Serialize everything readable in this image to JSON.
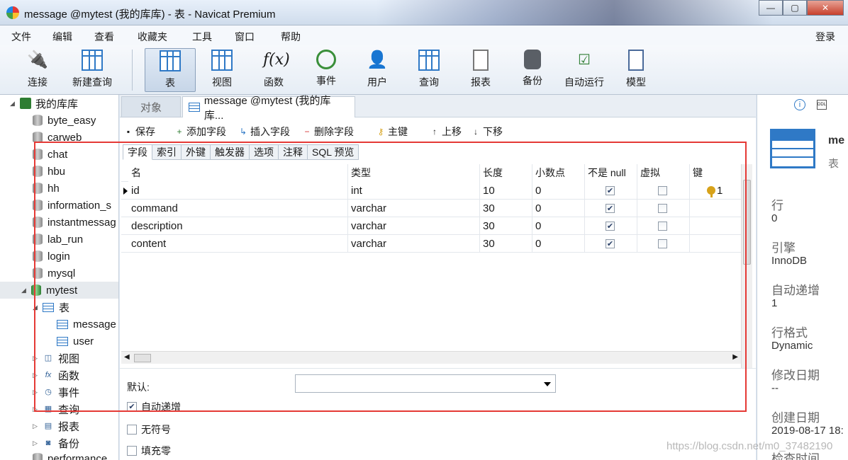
{
  "window": {
    "title": "message @mytest (我的库库) - 表 - Navicat Premium",
    "controls": [
      "—",
      "▢",
      "✕"
    ]
  },
  "menu": {
    "items": [
      "文件",
      "编辑",
      "查看",
      "收藏夹",
      "工具",
      "窗口",
      "帮助"
    ],
    "login": "登录"
  },
  "toolbar": {
    "buttons": [
      {
        "label": "连接",
        "icon": "plug-icon"
      },
      {
        "label": "新建查询",
        "icon": "new-query-icon"
      },
      {
        "label": "表",
        "icon": "table-icon"
      },
      {
        "label": "视图",
        "icon": "view-icon"
      },
      {
        "label": "函数",
        "icon": "function-icon"
      },
      {
        "label": "事件",
        "icon": "clock-icon"
      },
      {
        "label": "用户",
        "icon": "user-icon"
      },
      {
        "label": "查询",
        "icon": "query-icon"
      },
      {
        "label": "报表",
        "icon": "report-icon"
      },
      {
        "label": "备份",
        "icon": "backup-icon"
      },
      {
        "label": "自动运行",
        "icon": "checklist-icon"
      },
      {
        "label": "模型",
        "icon": "model-icon"
      }
    ],
    "active": "表"
  },
  "tree": {
    "connection": "我的库库",
    "databases": [
      "byte_easy",
      "carweb",
      "chat",
      "hbu",
      "hh",
      "information_s",
      "instantmessag",
      "lab_run",
      "login",
      "mysql",
      "mytest"
    ],
    "open_db": {
      "tables_label": "表",
      "tables": [
        "message",
        "user"
      ],
      "groups": [
        "视图",
        "函数",
        "事件",
        "查询",
        "报表",
        "备份"
      ]
    },
    "next_db": "performance"
  },
  "tabs": {
    "objects": "对象",
    "doc": "message @mytest (我的库库..."
  },
  "subtoolbar": {
    "save": "保存",
    "add_field": "添加字段",
    "insert_field": "插入字段",
    "delete_field": "删除字段",
    "primary_key": "主键",
    "move_up": "上移",
    "move_down": "下移"
  },
  "field_tabs": [
    "字段",
    "索引",
    "外键",
    "触发器",
    "选项",
    "注释",
    "SQL 预览"
  ],
  "grid": {
    "columns": [
      "名",
      "类型",
      "长度",
      "小数点",
      "不是 null",
      "虚拟",
      "键"
    ],
    "rows": [
      {
        "name": "id",
        "type": "int",
        "length": "10",
        "decimals": "0",
        "not_null": true,
        "virtual": false,
        "key": "1"
      },
      {
        "name": "command",
        "type": "varchar",
        "length": "30",
        "decimals": "0",
        "not_null": true,
        "virtual": false,
        "key": ""
      },
      {
        "name": "description",
        "type": "varchar",
        "length": "30",
        "decimals": "0",
        "not_null": true,
        "virtual": false,
        "key": ""
      },
      {
        "name": "content",
        "type": "varchar",
        "length": "30",
        "decimals": "0",
        "not_null": true,
        "virtual": false,
        "key": ""
      }
    ]
  },
  "props": {
    "default_label": "默认:",
    "auto_increment": "自动递增",
    "auto_increment_checked": true,
    "unsigned": "无符号",
    "zerofill": "填充零"
  },
  "info": {
    "name": "me",
    "kind": "表",
    "rows_label": "行",
    "rows_value": "0",
    "engine_label": "引擎",
    "engine_value": "InnoDB",
    "auto_inc_label": "自动递增",
    "auto_inc_value": "1",
    "row_format_label": "行格式",
    "row_format_value": "Dynamic",
    "modified_label": "修改日期",
    "modified_value": "--",
    "created_label": "创建日期",
    "created_value": "2019-08-17 18:",
    "checked_label": "检查时间"
  },
  "watermark": "https://blog.csdn.net/m0_37482190",
  "colors": {
    "accent": "#2f79c6",
    "highlight_box": "#e53935"
  }
}
